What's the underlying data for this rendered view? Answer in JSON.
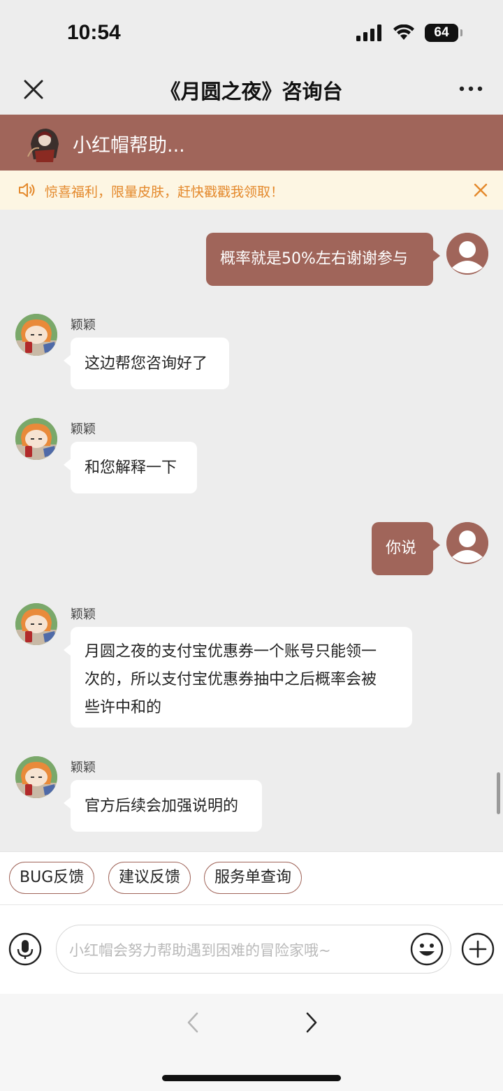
{
  "status_bar": {
    "time": "10:54",
    "battery": "64",
    "icons": [
      "signal-icon",
      "wifi-icon",
      "battery-icon"
    ]
  },
  "nav": {
    "title": "《月圆之夜》咨询台",
    "close_icon": "close-icon",
    "more_icon": "more-icon"
  },
  "banner": {
    "title": "小红帽帮助...",
    "bg_color": "#a0655a"
  },
  "notice": {
    "text": "惊喜福利，限量皮肤，赶快戳戳我领取！",
    "color": "#e4892c"
  },
  "messages": [
    {
      "side": "out",
      "text": "概率就是50%左右谢谢参与"
    },
    {
      "side": "in",
      "sender": "颖颖",
      "text": "这边帮您咨询好了"
    },
    {
      "side": "in",
      "sender": "颖颖",
      "text": "和您解释一下"
    },
    {
      "side": "out",
      "text": "你说"
    },
    {
      "side": "in",
      "sender": "颖颖",
      "text_lines": [
        "月圆之夜的支付宝优惠券一个账号只能领一",
        "次的，所以支付宝优惠券抽中之后概率会被",
        "些许中和的"
      ]
    },
    {
      "side": "in",
      "sender": "颖颖",
      "text": "官方后续会加强说明的"
    }
  ],
  "quick_replies": [
    "BUG反馈",
    "建议反馈",
    "服务单查询"
  ],
  "input": {
    "placeholder": "小红帽会努力帮助遇到困难的冒险家哦~"
  },
  "accent_color": "#a0655a"
}
